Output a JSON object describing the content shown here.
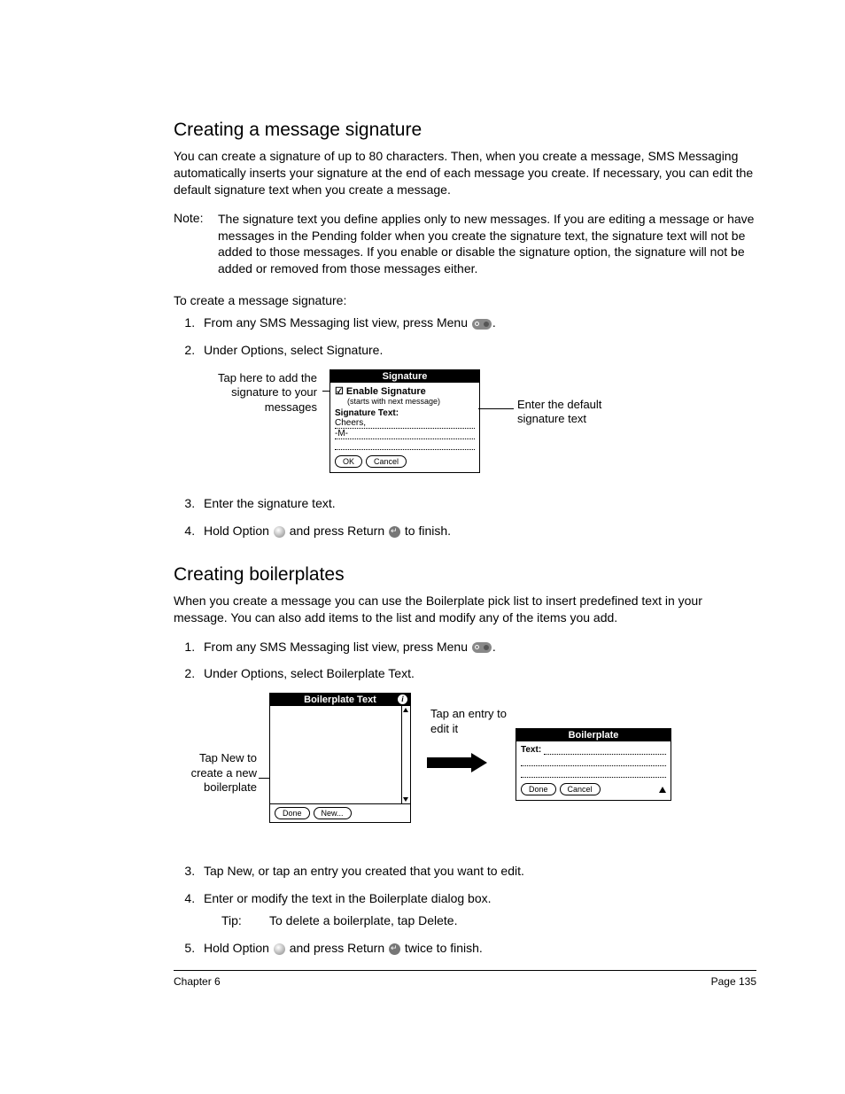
{
  "section1": {
    "heading": "Creating a message signature",
    "intro": "You can create a signature of up to 80 characters. Then, when you create a message, SMS Messaging automatically inserts your signature at the end of each message you create. If necessary, you can edit the default signature text when you create a message.",
    "note_label": "Note:",
    "note_body": "The signature text you define applies only to new messages. If you are editing a message or have messages in the Pending folder when you create the signature text, the signature text will not be added to those messages. If you enable or disable the signature option, the signature will not be added or removed from those messages either.",
    "subhead": "To create a message signature:",
    "step1_a": "From any SMS Messaging list view, press Menu ",
    "step1_b": ".",
    "step2": "Under Options, select Signature.",
    "sig_callout_left": "Tap here to add the signature to your messages",
    "sig_callout_right": "Enter the default signature text",
    "sig_title": "Signature",
    "sig_enable": "Enable Signature",
    "sig_sub": "(starts with next message)",
    "sig_field_label": "Signature Text:",
    "sig_line1": "Cheers,",
    "sig_line2": "-M-",
    "sig_ok": "OK",
    "sig_cancel": "Cancel",
    "step3": "Enter the signature text.",
    "step4_a": "Hold Option ",
    "step4_b": " and press Return ",
    "step4_c": " to finish."
  },
  "section2": {
    "heading": "Creating boilerplates",
    "intro": "When you create a message you can use the Boilerplate pick list to insert predefined text in your message. You can also add items to the list and modify any of the items you add.",
    "step1_a": "From any SMS Messaging list view, press Menu ",
    "step1_b": ".",
    "step2": "Under Options, select Boilerplate Text.",
    "bp_callout_left": "Tap New to create a new boilerplate",
    "bp_callout_tap": "Tap an entry to edit it",
    "bp_box1_title": "Boilerplate Text",
    "bp_done": "Done",
    "bp_new": "New...",
    "bp_box2_title": "Boilerplate",
    "bp_text_label": "Text:",
    "bp_cancel": "Cancel",
    "step3": "Tap New, or tap an entry you created that you want to edit.",
    "step4": "Enter or modify the text in the Boilerplate dialog box.",
    "tip_label": "Tip:",
    "tip_body": "To delete a boilerplate, tap Delete.",
    "step5_a": "Hold Option ",
    "step5_b": " and press Return ",
    "step5_c": " twice to finish."
  },
  "footer": {
    "left": "Chapter 6",
    "right": "Page 135"
  }
}
